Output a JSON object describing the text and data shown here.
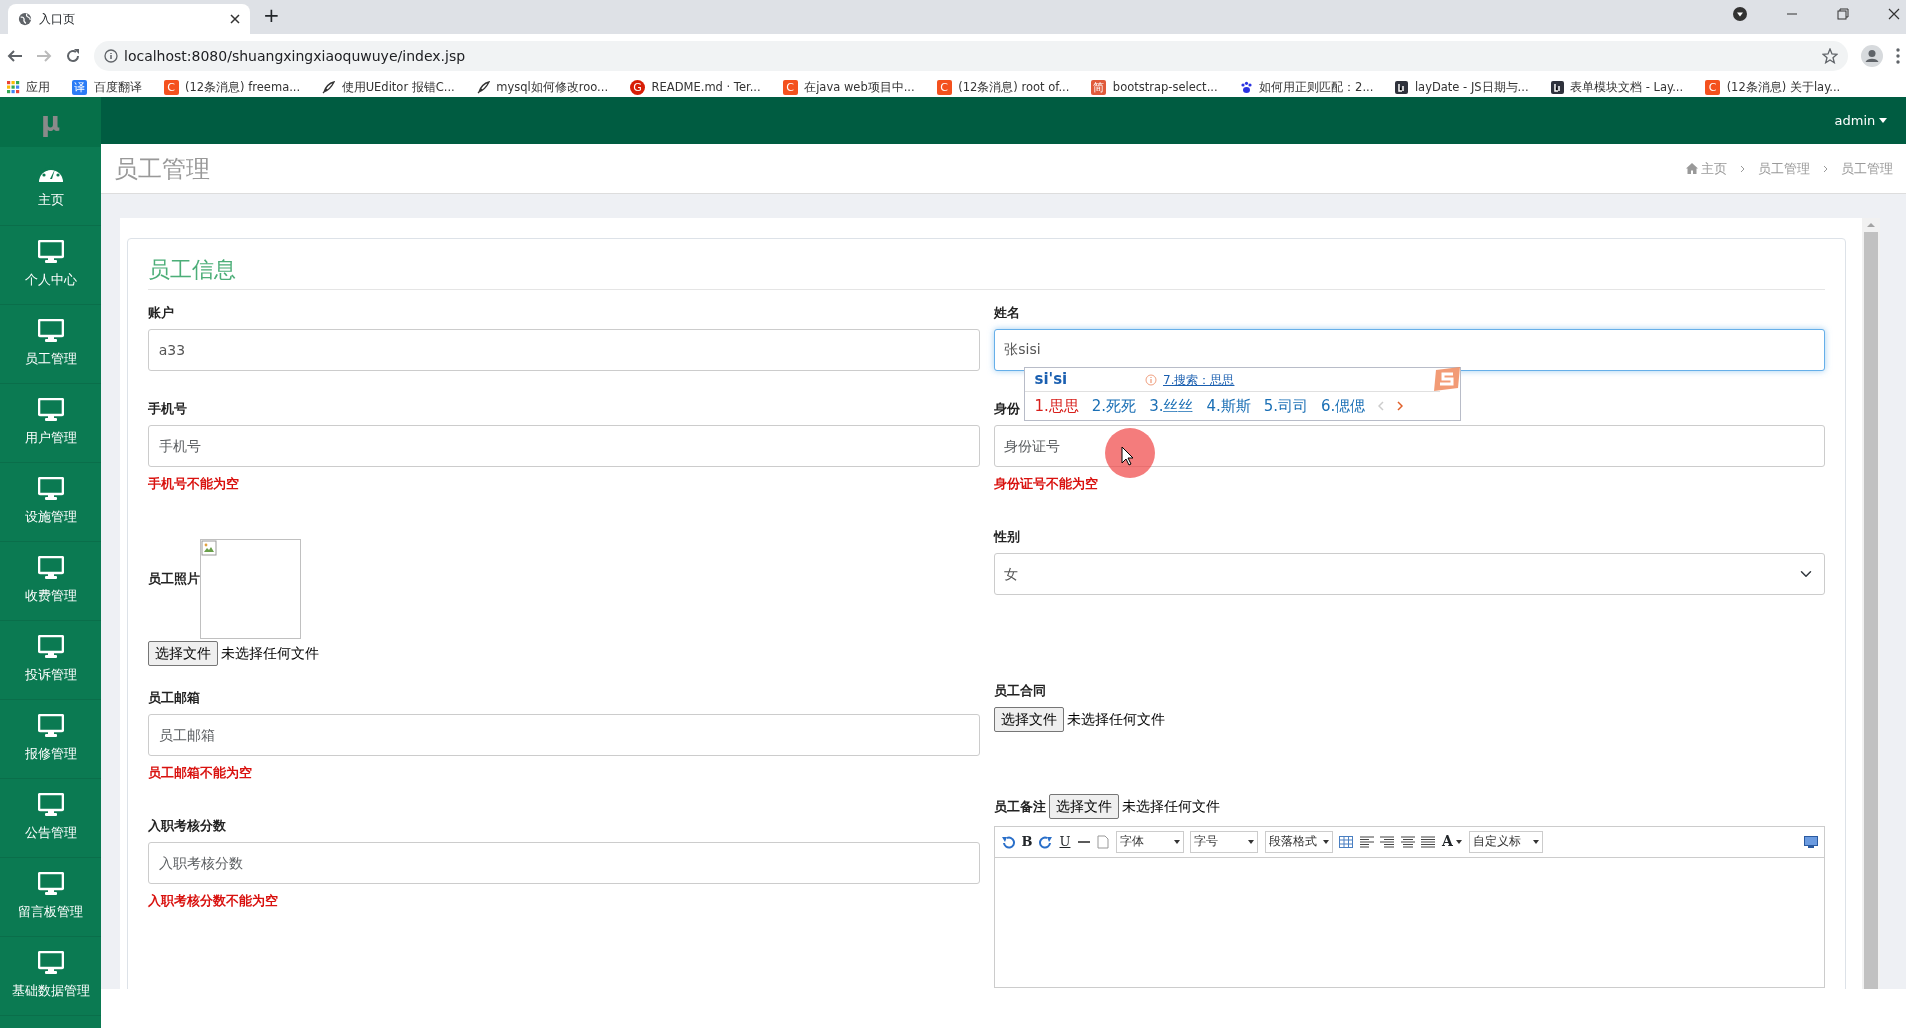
{
  "browser": {
    "tab_title": "入口页",
    "new_tab": "+",
    "url": "localhost:8080/shuangxingxiaoquwuye/index.jsp",
    "bookmarks": [
      {
        "label": "应用",
        "kind": "apps"
      },
      {
        "label": "百度翻译",
        "color": "#2b7cf6",
        "glyph": "译",
        "kind": "glyph"
      },
      {
        "label": "(12条消息) freema...",
        "color": "#f4511e",
        "glyph": "C",
        "kind": "glyph"
      },
      {
        "label": "使用UEditor 报错C...",
        "color": "#333333",
        "kind": "pen"
      },
      {
        "label": "mysql如何修改roo...",
        "color": "#333333",
        "kind": "pen"
      },
      {
        "label": "README.md · Ter...",
        "color": "#d81e06",
        "glyph": "G",
        "kind": "round"
      },
      {
        "label": "在java web项目中...",
        "color": "#f4511e",
        "glyph": "C",
        "kind": "glyph"
      },
      {
        "label": "(12条消息) root of...",
        "color": "#f4511e",
        "glyph": "C",
        "kind": "glyph"
      },
      {
        "label": "bootstrap-select...",
        "color": "#e05a3a",
        "glyph": "简",
        "kind": "glyph"
      },
      {
        "label": "如何用正则匹配：2...",
        "color": "#2932e1",
        "kind": "paw"
      },
      {
        "label": "layDate - JS日期与...",
        "color": "#2f323c",
        "kind": "layui"
      },
      {
        "label": "表单模块文档 - Lay...",
        "color": "#2f323c",
        "kind": "layui"
      },
      {
        "label": "(12条消息) 关于lay...",
        "color": "#f4511e",
        "glyph": "C",
        "kind": "glyph"
      }
    ]
  },
  "logo": "μ",
  "user_menu": "admin",
  "sidebar": {
    "items": [
      {
        "label": "主页",
        "kind": "gauge"
      },
      {
        "label": "个人中心",
        "kind": "monitor"
      },
      {
        "label": "员工管理",
        "kind": "monitor"
      },
      {
        "label": "用户管理",
        "kind": "monitor"
      },
      {
        "label": "设施管理",
        "kind": "monitor"
      },
      {
        "label": "收费管理",
        "kind": "monitor"
      },
      {
        "label": "投诉管理",
        "kind": "monitor"
      },
      {
        "label": "报修管理",
        "kind": "monitor"
      },
      {
        "label": "公告管理",
        "kind": "monitor"
      },
      {
        "label": "留言板管理",
        "kind": "monitor"
      },
      {
        "label": "基础数据管理",
        "kind": "monitor"
      }
    ]
  },
  "page_title": "员工管理",
  "breadcrumb": [
    "主页",
    "员工管理",
    "员工管理"
  ],
  "form": {
    "title": "员工信息",
    "left": [
      {
        "kind": "input",
        "label": "账户",
        "value": "a33"
      },
      {
        "kind": "input",
        "label": "手机号",
        "placeholder": "手机号",
        "error": "手机号不能为空"
      },
      {
        "kind": "photo",
        "label": "员工照片",
        "button": "选择文件",
        "file_status": "未选择任何文件"
      },
      {
        "kind": "input",
        "label": "员工邮箱",
        "placeholder": "员工邮箱",
        "error": "员工邮箱不能为空"
      },
      {
        "kind": "input",
        "label": "入职考核分数",
        "placeholder": "入职考核分数",
        "error": "入职考核分数不能为空"
      }
    ],
    "right": [
      {
        "kind": "input",
        "label": "姓名",
        "value": "张sisi",
        "focused": true
      },
      {
        "kind": "input",
        "label": "身份",
        "placeholder": "身份证号",
        "error": "身份证号不能为空"
      },
      {
        "kind": "select",
        "label": "性别",
        "value": "女"
      },
      {
        "kind": "file",
        "label": "员工合同",
        "button": "选择文件",
        "file_status": "未选择任何文件"
      },
      {
        "kind": "editor",
        "label": "员工备注",
        "button": "选择文件",
        "file_status": "未选择任何文件"
      }
    ]
  },
  "editor_toolbar": {
    "bold": "B",
    "underline": "U",
    "font_family": "字体",
    "font_size": "字号",
    "paragraph": "段落格式",
    "font_color": "A",
    "heading": "自定义标"
  },
  "ime": {
    "composition": "si'si",
    "search": "7.搜索：思思",
    "candidates": [
      {
        "label": "1.思思",
        "selected": true
      },
      {
        "label": "2.死死",
        "selected": false
      },
      {
        "label": "3.丝丝",
        "selected": false
      },
      {
        "label": "4.斯斯",
        "selected": false
      },
      {
        "label": "5.司司",
        "selected": false
      },
      {
        "label": "6.偲偲",
        "selected": false
      }
    ]
  }
}
